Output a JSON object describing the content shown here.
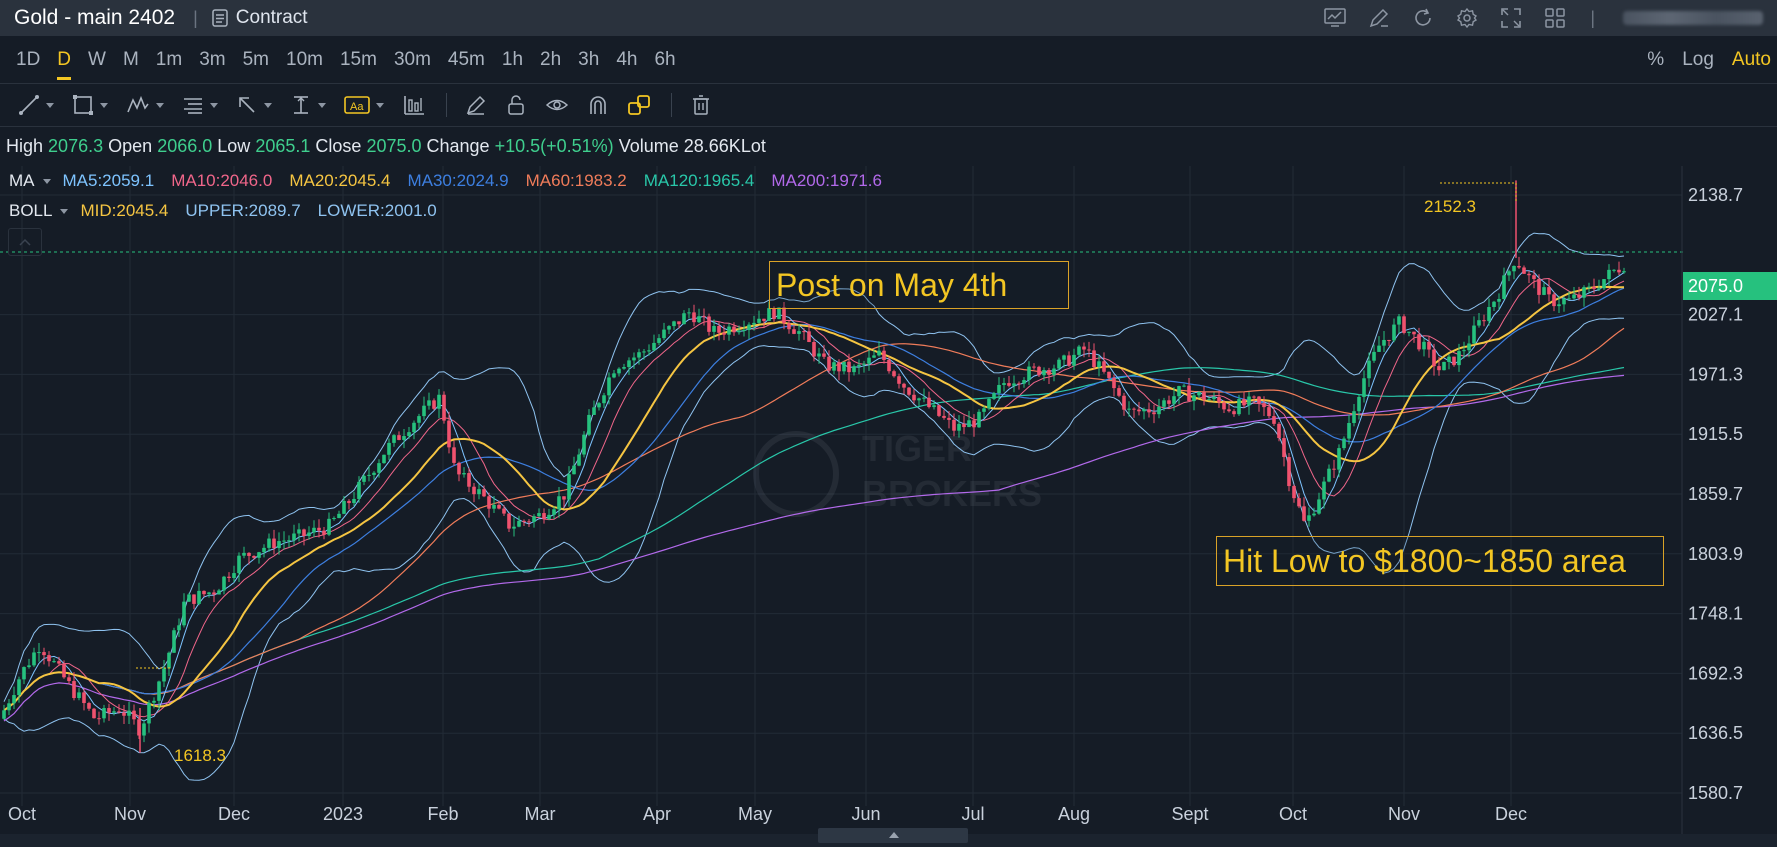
{
  "window": {
    "title": "Gold - main 2402",
    "contract_label": "Contract"
  },
  "toolbar_icons": [
    "chart-settings-icon",
    "draw-icon",
    "refresh-icon",
    "gear-icon",
    "fullscreen-icon",
    "layout-grid-icon"
  ],
  "intervals": [
    "1D",
    "D",
    "W",
    "M",
    "1m",
    "3m",
    "5m",
    "10m",
    "15m",
    "30m",
    "45m",
    "1h",
    "2h",
    "3h",
    "4h",
    "6h"
  ],
  "active_interval": "D",
  "scale_options": {
    "percent": "%",
    "log": "Log",
    "auto": "Auto"
  },
  "drawing_tools": [
    "trend-line-icon",
    "rectangle-icon",
    "pattern-icon",
    "fib-icon",
    "arrow-icon",
    "measure-icon",
    "text-tool-icon",
    "bars-pattern-icon",
    "pencil-icon",
    "lock-icon",
    "eye-icon",
    "magnet-icon",
    "link-icon",
    "trash-icon"
  ],
  "ohlc": {
    "high_label": "High",
    "high": "2076.3",
    "open_label": "Open",
    "open": "2066.0",
    "low_label": "Low",
    "low": "2065.1",
    "close_label": "Close",
    "close": "2075.0",
    "change_label": "Change",
    "change": "+10.5(+0.51%)",
    "volume_label": "Volume",
    "volume": "28.66KLot"
  },
  "ma": {
    "name": "MA",
    "items": [
      {
        "label": "MA5:2059.1",
        "color": "#7ec4ff"
      },
      {
        "label": "MA10:2046.0",
        "color": "#f0668a"
      },
      {
        "label": "MA20:2045.4",
        "color": "#f5c542"
      },
      {
        "label": "MA30:2024.9",
        "color": "#3d7fe0"
      },
      {
        "label": "MA60:1983.2",
        "color": "#f07c5a"
      },
      {
        "label": "MA120:1965.4",
        "color": "#29c7a9"
      },
      {
        "label": "MA200:1971.6",
        "color": "#b269ea"
      }
    ]
  },
  "boll": {
    "name": "BOLL",
    "items": [
      {
        "label": "MID:2045.4",
        "color": "#f5c542"
      },
      {
        "label": "UPPER:2089.7",
        "color": "#8fc3f0"
      },
      {
        "label": "LOWER:2001.0",
        "color": "#8fc3f0"
      }
    ]
  },
  "price_axis": [
    "2138.7",
    "2075.0",
    "2027.1",
    "1971.3",
    "1915.5",
    "1859.7",
    "1803.9",
    "1748.1",
    "1692.3",
    "1636.5",
    "1580.7"
  ],
  "current_price": "2075.0",
  "date_axis": [
    "Oct",
    "Nov",
    "Dec",
    "2023",
    "Feb",
    "Mar",
    "Apr",
    "May",
    "Jun",
    "Jul",
    "Aug",
    "Sept",
    "Oct",
    "Nov",
    "Dec"
  ],
  "annotations": {
    "post": "Post on May 4th",
    "low": "Hit Low to $1800~1850 area",
    "high_marker": "2152.3",
    "low_marker": "1618.3"
  },
  "watermark": [
    "TIGER",
    "BROKERS"
  ],
  "chart_data": {
    "type": "candlestick",
    "symbol": "Gold - main 2402",
    "timeframe": "D",
    "ylim": [
      1580.7,
      2152.3
    ],
    "x": [
      "Oct",
      "Nov",
      "Dec",
      "2023",
      "Feb",
      "Mar",
      "Apr",
      "May",
      "Jun",
      "Jul",
      "Aug",
      "Sept",
      "Oct",
      "Nov",
      "Dec"
    ],
    "close_trend": [
      1690,
      1650,
      1780,
      1830,
      1920,
      1830,
      1990,
      2030,
      1960,
      1930,
      1950,
      1920,
      1860,
      1990,
      2040,
      2075
    ],
    "period_high": 2152.3,
    "period_low": 1618.3,
    "last": {
      "open": 2066.0,
      "high": 2076.3,
      "low": 2065.1,
      "close": 2075.0
    }
  }
}
